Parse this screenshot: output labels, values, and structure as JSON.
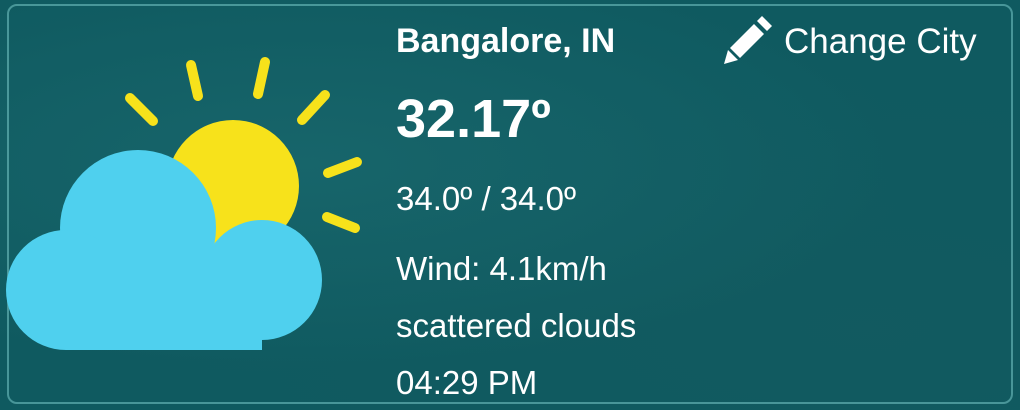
{
  "location": {
    "city": "Bangalore, IN"
  },
  "weather": {
    "temperature": "32.17º",
    "min_max": "34.0º / 34.0º",
    "wind": "Wind: 4.1km/h",
    "description": "scattered clouds",
    "time": "04:29 PM",
    "icon": "sun-behind-cloud-icon"
  },
  "actions": {
    "change_city_label": "Change City",
    "change_city_icon": "pencil-icon"
  },
  "colors": {
    "background": "#0f5a60",
    "sun": "#f7e21b",
    "cloud": "#4fd0ee",
    "text": "#ffffff"
  }
}
